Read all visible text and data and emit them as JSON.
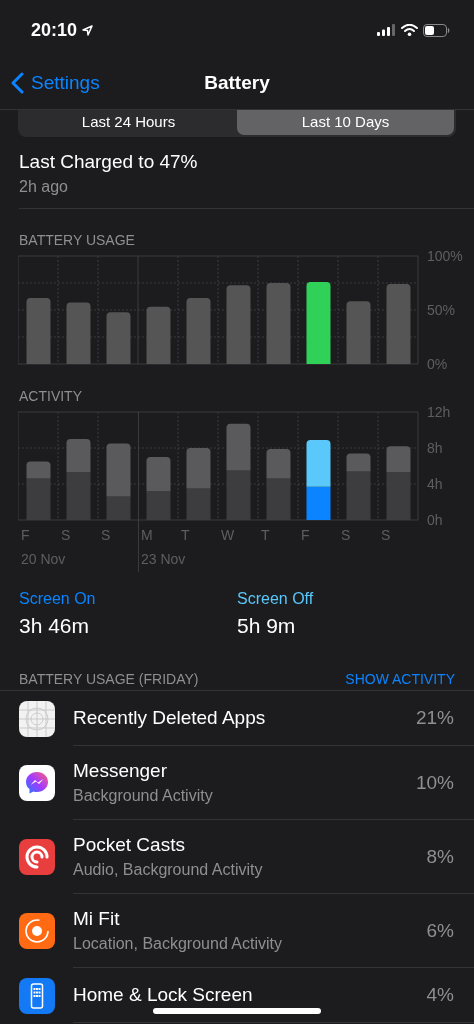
{
  "status_bar": {
    "time": "20:10"
  },
  "nav_bar": {
    "back": "Settings",
    "title": "Battery"
  },
  "segments": [
    {
      "label": "Last 24 Hours",
      "selected": false
    },
    {
      "label": "Last 10 Days",
      "selected": true
    }
  ],
  "last_charged": {
    "title": "Last Charged to 47%",
    "subtitle": "2h ago"
  },
  "battery_usage": {
    "title": "BATTERY USAGE",
    "chart_data": {
      "type": "bar",
      "ylim": [
        0,
        100
      ],
      "yticks": [
        {
          "value": 0,
          "label": "0%"
        },
        {
          "value": 50,
          "label": "50%"
        },
        {
          "value": 100,
          "label": "100%"
        }
      ],
      "series": [
        {
          "color": "#555555",
          "values": [
            61,
            57,
            48,
            53,
            61,
            73,
            75,
            null,
            58,
            74
          ]
        },
        {
          "color": "#30d158",
          "values": [
            null,
            null,
            null,
            null,
            null,
            null,
            null,
            76,
            null,
            null
          ]
        }
      ]
    }
  },
  "activity": {
    "title": "ACTIVITY",
    "chart_data": {
      "type": "bar",
      "stacked": true,
      "categories": [
        "F",
        "S",
        "S",
        "M",
        "T",
        "W",
        "T",
        "F",
        "S",
        "S"
      ],
      "ylim": [
        0,
        12
      ],
      "yticks": [
        {
          "value": 0,
          "label": "0h"
        },
        {
          "value": 4,
          "label": "4h"
        },
        {
          "value": 8,
          "label": "8h"
        },
        {
          "value": 12,
          "label": "12h"
        }
      ],
      "series": [
        {
          "color": "#3d3d3f",
          "values": [
            4.6,
            5.3,
            2.6,
            3.2,
            3.5,
            5.5,
            4.6,
            null,
            5.4,
            5.3
          ]
        },
        {
          "color": "#5a5a5c",
          "values": [
            1.9,
            3.7,
            5.9,
            3.8,
            4.5,
            5.2,
            3.3,
            null,
            2.0,
            2.9
          ]
        },
        {
          "color": "#0a84ff",
          "values": [
            null,
            null,
            null,
            null,
            null,
            null,
            null,
            3.7,
            null,
            null
          ]
        },
        {
          "color": "#5ac8fa",
          "values": [
            null,
            null,
            null,
            null,
            null,
            null,
            null,
            5.2,
            null,
            null
          ]
        }
      ],
      "annotations": [
        "20 Nov",
        "23 Nov"
      ]
    }
  },
  "screen_time": [
    {
      "label": "Screen On",
      "value": "3h 46m",
      "color": "#0a84ff"
    },
    {
      "label": "Screen Off",
      "value": "5h 9m",
      "color": "#5ac8fa"
    }
  ],
  "apps_section": {
    "title": "BATTERY USAGE (FRIDAY)",
    "action": "SHOW ACTIVITY",
    "rows": [
      {
        "kind": "deleted",
        "name": "Recently Deleted Apps",
        "percent": "21%"
      },
      {
        "kind": "messenger",
        "name": "Messenger",
        "detail": "Background Activity",
        "percent": "10%"
      },
      {
        "kind": "podcast",
        "name": "Pocket Casts",
        "detail": "Audio, Background Activity",
        "percent": "8%"
      },
      {
        "kind": "fitness",
        "name": "Mi Fit",
        "detail": "Location, Background Activity",
        "percent": "6%"
      },
      {
        "kind": "home",
        "name": "Home & Lock Screen",
        "percent": "4%"
      }
    ]
  }
}
